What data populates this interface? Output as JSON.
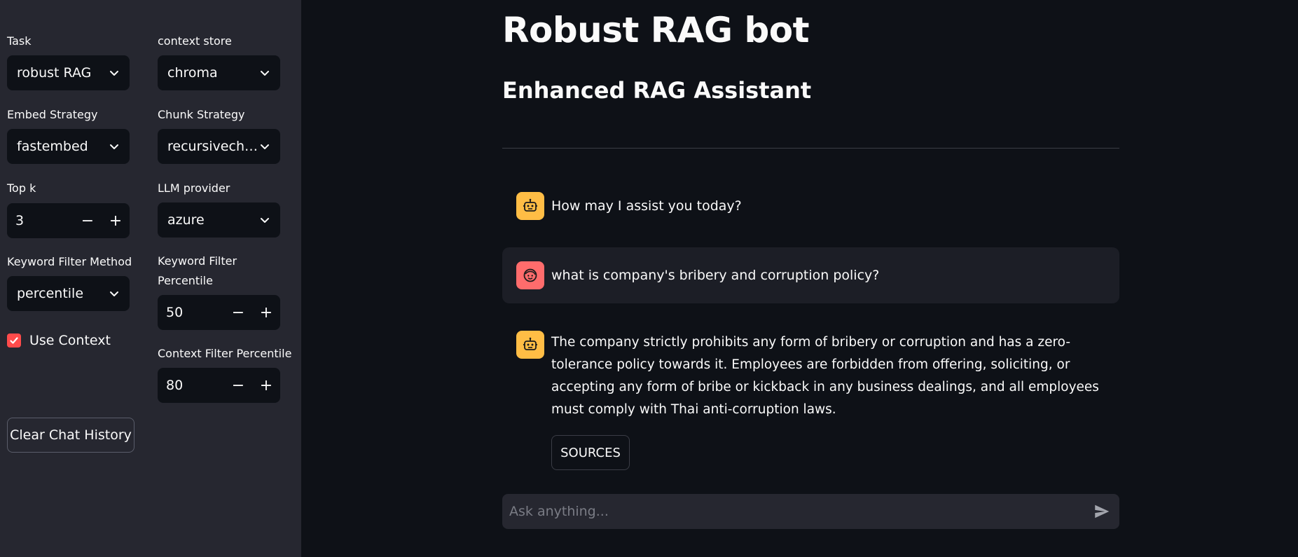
{
  "sidebar": {
    "task": {
      "label": "Task",
      "value": "robust RAG"
    },
    "context_store": {
      "label": "context store",
      "value": "chroma"
    },
    "embed_strategy": {
      "label": "Embed Strategy",
      "value": "fastembed"
    },
    "chunk_strategy": {
      "label": "Chunk Strategy",
      "value": "recursivecharacter"
    },
    "top_k": {
      "label": "Top k",
      "value": "3"
    },
    "llm_provider": {
      "label": "LLM provider",
      "value": "azure"
    },
    "keyword_filter_method": {
      "label": "Keyword Filter Method",
      "value": "percentile"
    },
    "keyword_filter_percentile": {
      "label": "Keyword Filter Percentile",
      "value": "50"
    },
    "use_context": {
      "label": "Use Context",
      "checked": true
    },
    "context_filter_percentile": {
      "label": "Context Filter Percentile",
      "value": "80"
    },
    "clear_button": "Clear Chat History",
    "minus": "−",
    "plus": "+"
  },
  "main": {
    "title": "Robust RAG bot",
    "subtitle": "Enhanced RAG Assistant",
    "messages": [
      {
        "role": "assistant",
        "text": "How may I assist you today?"
      },
      {
        "role": "user",
        "text": "what is company's bribery and corruption policy?"
      },
      {
        "role": "assistant",
        "text": "The company strictly prohibits any form of bribery or corruption and has a zero-tolerance policy towards it. Employees are forbidden from offering, soliciting, or accepting any form of bribe or kickback in any business dealings, and all employees must comply with Thai anti-corruption laws."
      }
    ],
    "sources_button": "SOURCES",
    "chat_input": {
      "placeholder": "Ask anything..."
    }
  },
  "colors": {
    "accent": "#ff4b4b",
    "bot_avatar": "#ffbd45",
    "user_avatar": "#ff6c6c",
    "sidebar_bg": "#262730",
    "main_bg": "#0e1117"
  },
  "icons": {
    "select_chevron": "chevron-down-icon",
    "bot_avatar": "robot-icon",
    "user_avatar": "face-icon",
    "send": "send-icon",
    "checkbox": "checkmark-icon"
  }
}
